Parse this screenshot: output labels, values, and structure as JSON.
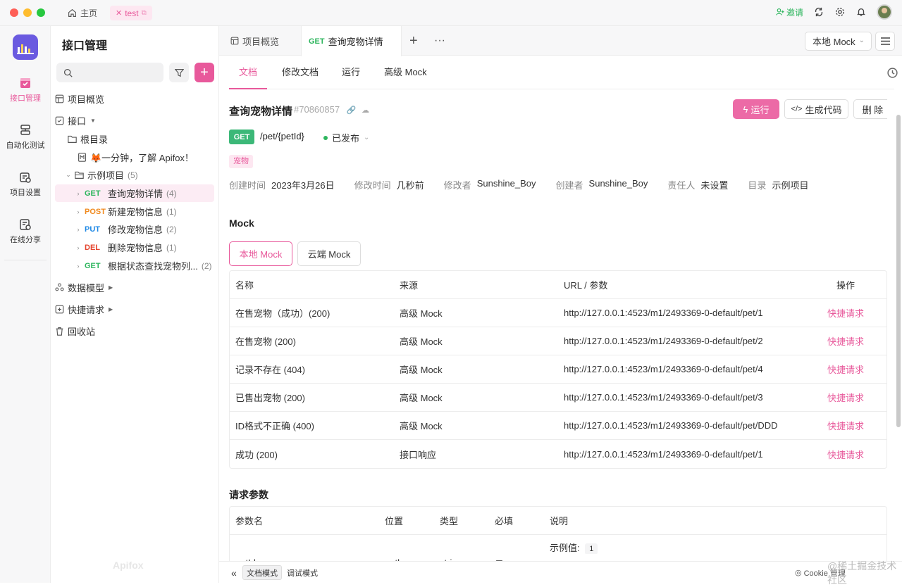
{
  "titlebar": {
    "home_label": "主页",
    "project_tab": "test",
    "invite_label": "邀请"
  },
  "rail": {
    "items": [
      "接口管理",
      "自动化测试",
      "项目设置",
      "在线分享"
    ]
  },
  "sidebar": {
    "title": "接口管理",
    "search_placeholder": "",
    "overview": "项目概览",
    "interfaces": "接口",
    "root_dir": "根目录",
    "intro_doc": "🦊一分钟，了解 Apifox！",
    "example_folder": "示例项目",
    "example_count": "(5)",
    "apis": [
      {
        "method": "GET",
        "name": "查询宠物详情",
        "count": "(4)"
      },
      {
        "method": "POST",
        "name": "新建宠物信息",
        "count": "(1)"
      },
      {
        "method": "PUT",
        "name": "修改宠物信息",
        "count": "(2)"
      },
      {
        "method": "DEL",
        "name": "删除宠物信息",
        "count": "(1)"
      },
      {
        "method": "GET",
        "name": "根据状态查找宠物列...",
        "count": "(2)"
      }
    ],
    "data_models": "数据模型",
    "quick_request": "快捷请求",
    "recycle": "回收站",
    "brand": "Apifox"
  },
  "tabs": {
    "overview": "项目概览",
    "active_method": "GET",
    "active_name": "查询宠物详情",
    "mock_env": "本地 Mock"
  },
  "subtabs": [
    "文档",
    "修改文档",
    "运行",
    "高级 Mock"
  ],
  "api": {
    "name": "查询宠物详情",
    "id": "#70860857",
    "run_label": "运行",
    "code_label": "生成代码",
    "delete_label": "删 除",
    "method": "GET",
    "path": "/pet/{petId}",
    "status": "已发布",
    "tag": "宠物",
    "meta": [
      {
        "k": "创建时间",
        "v": "2023年3月26日"
      },
      {
        "k": "修改时间",
        "v": "几秒前"
      },
      {
        "k": "修改者",
        "v": "Sunshine_Boy"
      },
      {
        "k": "创建者",
        "v": "Sunshine_Boy"
      },
      {
        "k": "责任人",
        "v": "未设置"
      },
      {
        "k": "目录",
        "v": "示例项目"
      }
    ]
  },
  "mock": {
    "title": "Mock",
    "seg_local": "本地 Mock",
    "seg_cloud": "云端 Mock",
    "headers": [
      "名称",
      "来源",
      "URL / 参数",
      "操作"
    ],
    "rows": [
      {
        "name": "在售宠物（成功）(200)",
        "source": "高级 Mock",
        "url": "http://127.0.0.1:4523/m1/2493369-0-default/pet/1",
        "action": "快捷请求"
      },
      {
        "name": "在售宠物 (200)",
        "source": "高级 Mock",
        "url": "http://127.0.0.1:4523/m1/2493369-0-default/pet/2",
        "action": "快捷请求"
      },
      {
        "name": "记录不存在 (404)",
        "source": "高级 Mock",
        "url": "http://127.0.0.1:4523/m1/2493369-0-default/pet/4",
        "action": "快捷请求"
      },
      {
        "name": "已售出宠物 (200)",
        "source": "高级 Mock",
        "url": "http://127.0.0.1:4523/m1/2493369-0-default/pet/3",
        "action": "快捷请求"
      },
      {
        "name": "ID格式不正确 (400)",
        "source": "高级 Mock",
        "url": "http://127.0.0.1:4523/m1/2493369-0-default/pet/DDD",
        "action": "快捷请求"
      },
      {
        "name": "成功 (200)",
        "source": "接口响应",
        "url": "http://127.0.0.1:4523/m1/2493369-0-default/pet/1",
        "action": "快捷请求"
      }
    ]
  },
  "params": {
    "title": "请求参数",
    "headers": [
      "参数名",
      "位置",
      "类型",
      "必填",
      "说明"
    ],
    "row": {
      "name": "petId",
      "location": "path",
      "type": "string",
      "required": "是",
      "example_label": "示例值:",
      "example_value": "1"
    }
  },
  "footer": {
    "doc_mode": "文档模式",
    "debug_mode": "调试模式",
    "cookie": "Cookie 管理",
    "corner_text": "@稀土掘金技术社区"
  }
}
